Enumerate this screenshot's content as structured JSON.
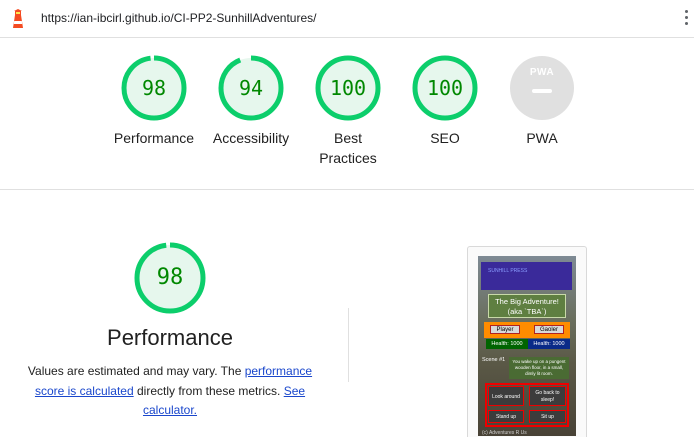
{
  "urlbar": {
    "url": "https://ian-ibcirl.github.io/CI-PP2-SunhillAdventures/",
    "logo_icon": "lighthouse-icon",
    "menu_icon": "more-vertical-icon"
  },
  "scores": [
    {
      "label": "Performance",
      "value": "98",
      "score": 98
    },
    {
      "label": "Accessibility",
      "value": "94",
      "score": 94
    },
    {
      "label": "Best Practices",
      "value": "100",
      "score": 100
    },
    {
      "label": "SEO",
      "value": "100",
      "score": 100
    }
  ],
  "pwa": {
    "label": "PWA",
    "badge_text": "PWA"
  },
  "colors": {
    "pass": "#0cce6b",
    "pass_fill": "#e6f7ed",
    "pass_text": "#008800",
    "pwa_gray": "#e0e0e0",
    "link": "#1a47cc"
  },
  "performance": {
    "score": "98",
    "score_fraction": 0.98,
    "title": "Performance",
    "desc_part1": "Values are estimated and may vary. The ",
    "desc_link1": "performance score is calculated",
    "desc_part2": " directly from these metrics. ",
    "desc_link2": "See calculator."
  },
  "thumbnail": {
    "banner_text": "SUNHILL PRESS",
    "title_line1": "The Big Adventure!",
    "title_line2": "(aka `TBA`)",
    "player_label": "Player",
    "gaoler_label": "Gaoler",
    "player_health": "Health: 1000",
    "gaoler_health": "Health: 1000",
    "scene_label": "Scene #1",
    "scene_text": "You wake up on a pungent wooden floor, in a small, dimly lit room.",
    "btn_look": "Look around",
    "btn_sleep": "Go back to sleep!",
    "btn_stand": "Stand up",
    "btn_sit": "Sit up",
    "footer": "(c) Adventures R Us"
  }
}
